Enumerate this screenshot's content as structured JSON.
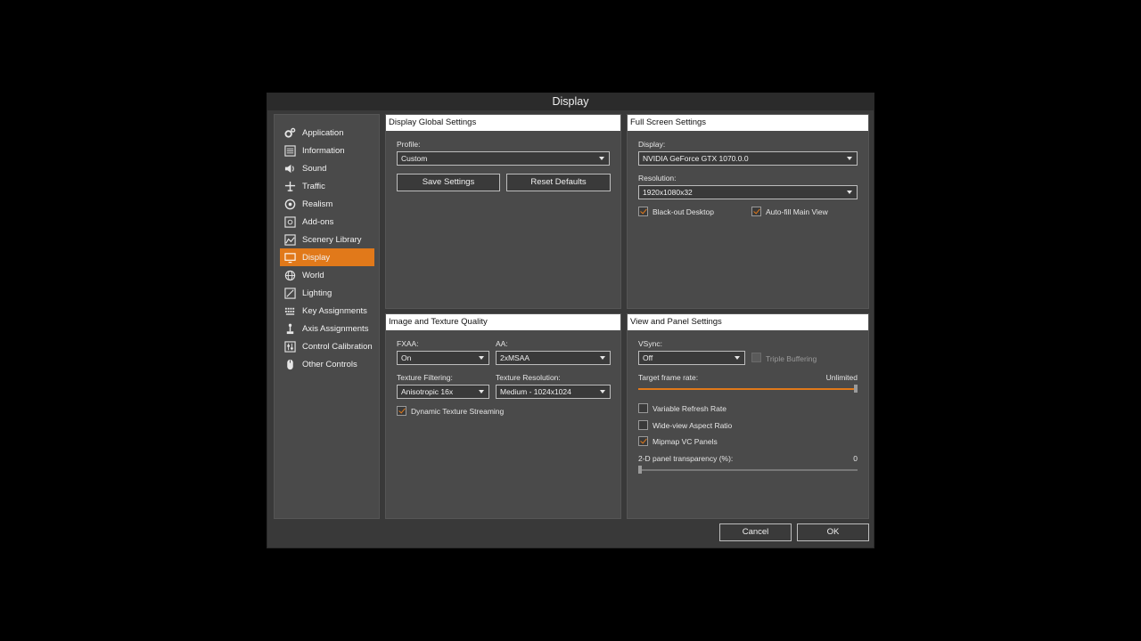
{
  "dialog": {
    "title": "Display"
  },
  "sidebar": {
    "items": [
      {
        "label": "Application",
        "icon": "gears-icon"
      },
      {
        "label": "Information",
        "icon": "list-icon"
      },
      {
        "label": "Sound",
        "icon": "speaker-icon"
      },
      {
        "label": "Traffic",
        "icon": "aircraft-icon"
      },
      {
        "label": "Realism",
        "icon": "realism-icon"
      },
      {
        "label": "Add-ons",
        "icon": "plugin-icon"
      },
      {
        "label": "Scenery Library",
        "icon": "landscape-icon"
      },
      {
        "label": "Display",
        "icon": "monitor-icon",
        "active": true
      },
      {
        "label": "World",
        "icon": "globe-icon"
      },
      {
        "label": "Lighting",
        "icon": "lighting-icon"
      },
      {
        "label": "Key Assignments",
        "icon": "keyboard-icon"
      },
      {
        "label": "Axis Assignments",
        "icon": "joystick-icon"
      },
      {
        "label": "Control Calibration",
        "icon": "calibration-icon"
      },
      {
        "label": "Other Controls",
        "icon": "mouse-icon"
      }
    ]
  },
  "global": {
    "header": "Display Global Settings",
    "profile_label": "Profile:",
    "profile_value": "Custom",
    "save_label": "Save Settings",
    "reset_label": "Reset Defaults"
  },
  "fullscreen": {
    "header": "Full Screen Settings",
    "display_label": "Display:",
    "display_value": "NVIDIA GeForce GTX 1070.0.0",
    "resolution_label": "Resolution:",
    "resolution_value": "1920x1080x32",
    "blackout_label": "Black-out Desktop",
    "blackout_checked": true,
    "autofill_label": "Auto-fill Main View",
    "autofill_checked": true
  },
  "quality": {
    "header": "Image and Texture Quality",
    "fxaa_label": "FXAA:",
    "fxaa_value": "On",
    "aa_label": "AA:",
    "aa_value": "2xMSAA",
    "filter_label": "Texture Filtering:",
    "filter_value": "Anisotropic 16x",
    "texres_label": "Texture Resolution:",
    "texres_value": "Medium - 1024x1024",
    "streaming_label": "Dynamic Texture Streaming",
    "streaming_checked": true
  },
  "view": {
    "header": "View and Panel Settings",
    "vsync_label": "VSync:",
    "vsync_value": "Off",
    "triple_label": "Triple Buffering",
    "triple_checked": false,
    "target_label": "Target frame rate:",
    "target_value": "Unlimited",
    "target_fraction": 1.0,
    "vrr_label": "Variable Refresh Rate",
    "vrr_checked": false,
    "wide_label": "Wide-view Aspect Ratio",
    "wide_checked": false,
    "mipmap_label": "Mipmap VC Panels",
    "mipmap_checked": true,
    "transparency_label": "2-D panel transparency (%):",
    "transparency_value": "0",
    "transparency_fraction": 0.0
  },
  "footer": {
    "cancel_label": "Cancel",
    "ok_label": "OK"
  },
  "colors": {
    "accent": "#e1791a",
    "background": "#393939",
    "panel": "#4a4a4a"
  }
}
